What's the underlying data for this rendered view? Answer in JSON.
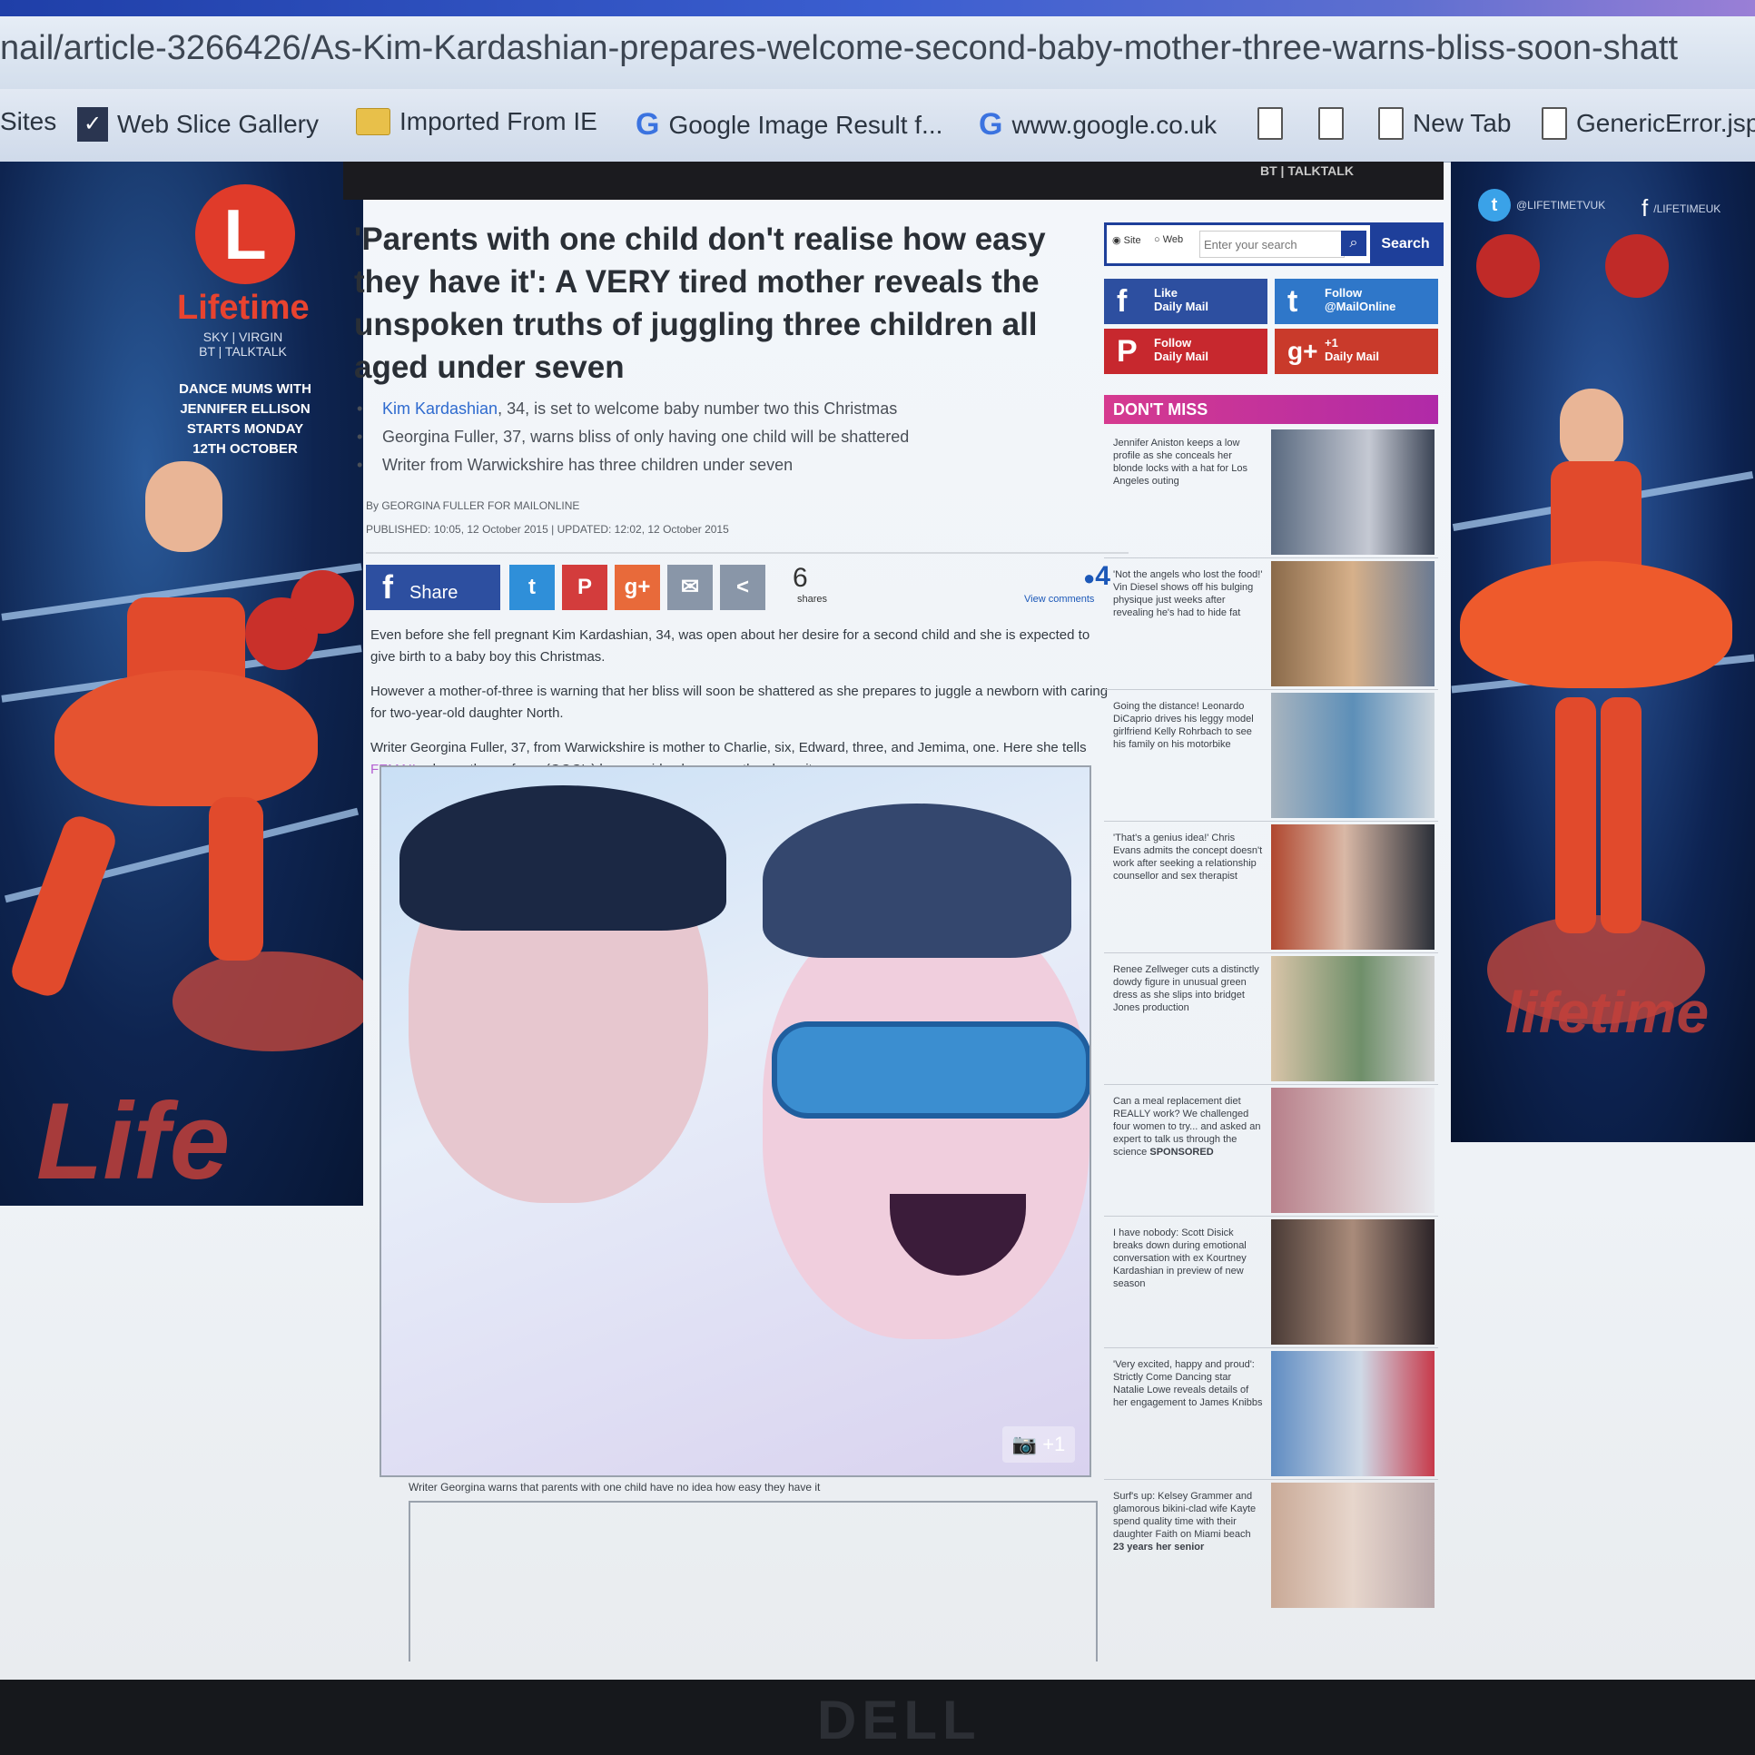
{
  "browser": {
    "url": "nail/article-3266426/As-Kim-Kardashian-prepares-welcome-second-baby-mother-three-warns-bliss-soon-shatt",
    "favorites": [
      {
        "label": "Sites",
        "icon": "none"
      },
      {
        "label": "Web Slice Gallery",
        "icon": "web-slice-icon"
      },
      {
        "label": "Imported From IE",
        "icon": "folder-icon"
      },
      {
        "label": "Google Image Result f...",
        "icon": "google-icon"
      },
      {
        "label": "www.google.co.uk",
        "icon": "google-icon"
      },
      {
        "label": "",
        "icon": "page-icon"
      },
      {
        "label": "",
        "icon": "page-icon"
      },
      {
        "label": "New Tab",
        "icon": "page-icon"
      },
      {
        "label": "GenericError.jsp:",
        "icon": "page-icon"
      }
    ]
  },
  "ad_left": {
    "logo_letter": "L",
    "brand": "Lifetime",
    "channels": "SKY | VIRGIN\nBT | TALKTALK",
    "promo": "DANCE MUMS WITH JENNIFER ELLISON STARTS MONDAY 12TH OCTOBER",
    "floor_text": "Life"
  },
  "ad_right": {
    "twitter_handle": "@LIFETIMETVUK",
    "facebook_handle": "/LIFETIMEUK",
    "floor_text": "lifetime"
  },
  "hero_caption": "BT | TALKTALK",
  "article": {
    "headline": "'Parents with one child don't realise how easy they have it': A VERY tired mother reveals the unspoken truths of juggling three children all aged under seven",
    "bullets": [
      {
        "link": "Kim Kardashian",
        "text": ", 34, is set to welcome baby number two this Christmas"
      },
      {
        "link": "",
        "text": "Georgina Fuller, 37, warns bliss of only having one child will be shattered"
      },
      {
        "link": "",
        "text": "Writer from Warwickshire has three children under seven"
      }
    ],
    "byline": "By GEORGINA FULLER FOR MAILONLINE",
    "published": "PUBLISHED: 10:05, 12 October 2015 | UPDATED: 12:02, 12 October 2015",
    "share_label": "Share",
    "share_count": "6",
    "share_count_label": "shares",
    "comment_count": "4",
    "comment_label": "View comments",
    "paragraphs": [
      "Even before she fell pregnant Kim Kardashian, 34, was open about her desire for a second child and she is expected to give birth to a baby boy this Christmas.",
      "However a mother-of-three is warning that her bliss will soon be shattered as she prepares to juggle a newborn with caring for two-year-old daughter North."
    ],
    "para3_before": "Writer Georgina Fuller, 37, from Warwickshire is mother to Charlie, six, Edward, three, and Jemima, one. Here she tells ",
    "para3_link": "FEMAIL",
    "para3_after": " why mothers of one (OOO's) have no idea how easy they have it.",
    "photo_caption": "Writer Georgina warns that parents with one child have no idea how easy they have it",
    "photo_badge": "+1"
  },
  "sidebar": {
    "radio1": "Site",
    "radio2": "Web",
    "search_placeholder": "Enter your search",
    "search_button": "Search",
    "social": [
      {
        "icon": "f",
        "line1": "Like",
        "line2": "Daily Mail",
        "color": "#2d4fa0"
      },
      {
        "icon": "t",
        "line1": "Follow",
        "line2": "@MailOnline",
        "color": "#2f77c9"
      },
      {
        "icon": "P",
        "line1": "Follow",
        "line2": "Daily Mail",
        "color": "#c7282e"
      },
      {
        "icon": "g+",
        "line1": "+1",
        "line2": "Daily Mail",
        "color": "#c93a2b"
      }
    ],
    "dont_miss_title": "DON'T MISS",
    "dont_miss": [
      "Jennifer Aniston keeps a low profile as she conceals her blonde locks with a hat for Los Angeles outing",
      "'Not the angels who lost the food!' Vin Diesel shows off his bulging physique just weeks after revealing he's had to hide fat",
      "Going the distance! Leonardo DiCaprio drives his leggy model girlfriend Kelly Rohrbach to see his family on his motorbike",
      "'That's a genius idea!' Chris Evans admits the concept doesn't work after seeking a relationship counsellor and sex therapist",
      "Renee Zellweger cuts a distinctly dowdy figure in unusual green dress as she slips into bridget Jones production",
      "Can a meal replacement diet REALLY work? We challenged four women to try... and asked an expert to talk us through the science",
      "I have nobody: Scott Disick breaks down during emotional conversation with ex Kourtney Kardashian in preview of new season",
      "'Very excited, happy and proud': Strictly Come Dancing star Natalie Lowe reveals details of her engagement to James Knibbs",
      "Surf's up: Kelsey Grammer and glamorous bikini-clad wife Kayte spend quality time with their daughter Faith on Miami beach"
    ],
    "dont_miss_sponsored": "SPONSORED",
    "dont_miss_last_meta": "23 years her senior"
  },
  "monitor": {
    "brand": "DELL"
  }
}
